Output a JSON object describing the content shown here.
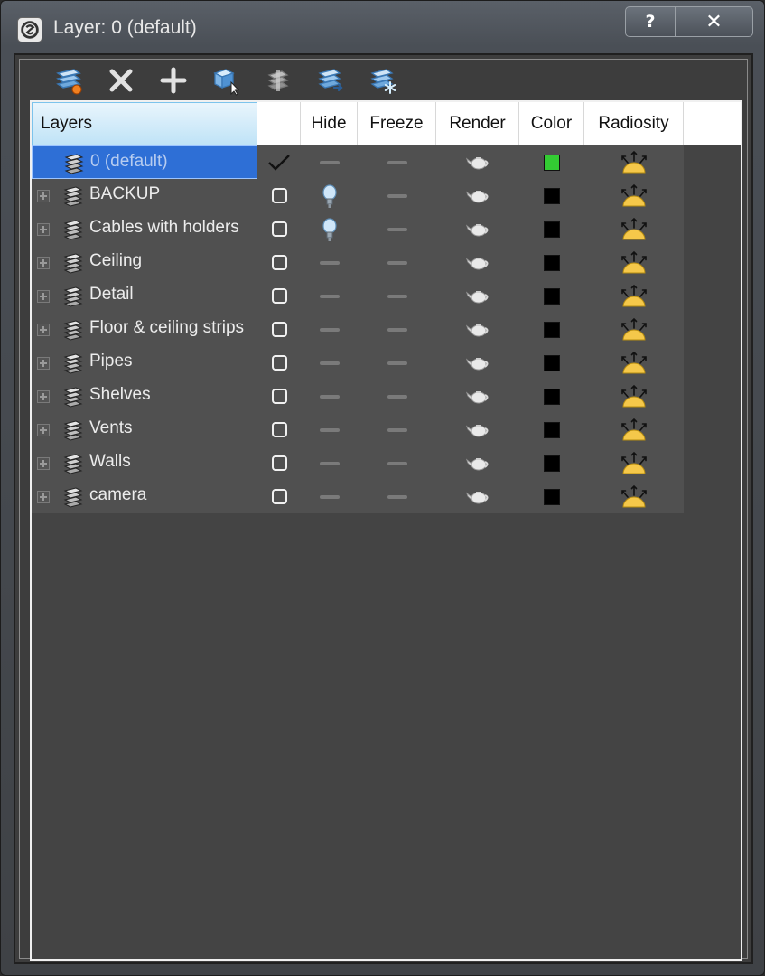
{
  "window": {
    "title": "Layer: 0 (default)",
    "help_label": "?",
    "close_label": "✕"
  },
  "toolbar": {
    "buttons": [
      {
        "name": "create-new-layer-button",
        "icon": "new-layer-icon"
      },
      {
        "name": "delete-layer-button",
        "icon": "x-icon"
      },
      {
        "name": "add-selection-button",
        "icon": "plus-icon"
      },
      {
        "name": "select-highlighted-button",
        "icon": "select-cube-icon"
      },
      {
        "name": "highlight-selected-button",
        "icon": "highlight-layer-icon"
      },
      {
        "name": "hide-unhide-all-button",
        "icon": "layers-arrow-icon"
      },
      {
        "name": "freeze-unfreeze-all-button",
        "icon": "layers-snowflake-icon"
      }
    ]
  },
  "columns": {
    "layers": "Layers",
    "current": "",
    "hide": "Hide",
    "freeze": "Freeze",
    "render": "Render",
    "color": "Color",
    "radiosity": "Radiosity"
  },
  "layers": [
    {
      "name": "0 (default)",
      "current": true,
      "hidden": false,
      "selected": true,
      "expandable": false,
      "color": "#33cc33"
    },
    {
      "name": "BACKUP",
      "current": false,
      "hidden": true,
      "selected": false,
      "expandable": true,
      "color": "#000000"
    },
    {
      "name": "Cables with holders",
      "current": false,
      "hidden": true,
      "selected": false,
      "expandable": true,
      "color": "#000000"
    },
    {
      "name": "Ceiling",
      "current": false,
      "hidden": false,
      "selected": false,
      "expandable": true,
      "color": "#000000"
    },
    {
      "name": "Detail",
      "current": false,
      "hidden": false,
      "selected": false,
      "expandable": true,
      "color": "#000000"
    },
    {
      "name": "Floor & ceiling strips",
      "current": false,
      "hidden": false,
      "selected": false,
      "expandable": true,
      "color": "#000000"
    },
    {
      "name": "Pipes",
      "current": false,
      "hidden": false,
      "selected": false,
      "expandable": true,
      "color": "#000000"
    },
    {
      "name": "Shelves",
      "current": false,
      "hidden": false,
      "selected": false,
      "expandable": true,
      "color": "#000000"
    },
    {
      "name": "Vents",
      "current": false,
      "hidden": false,
      "selected": false,
      "expandable": true,
      "color": "#000000"
    },
    {
      "name": "Walls",
      "current": false,
      "hidden": false,
      "selected": false,
      "expandable": true,
      "color": "#000000"
    },
    {
      "name": "camera",
      "current": false,
      "hidden": false,
      "selected": false,
      "expandable": true,
      "color": "#000000"
    }
  ]
}
